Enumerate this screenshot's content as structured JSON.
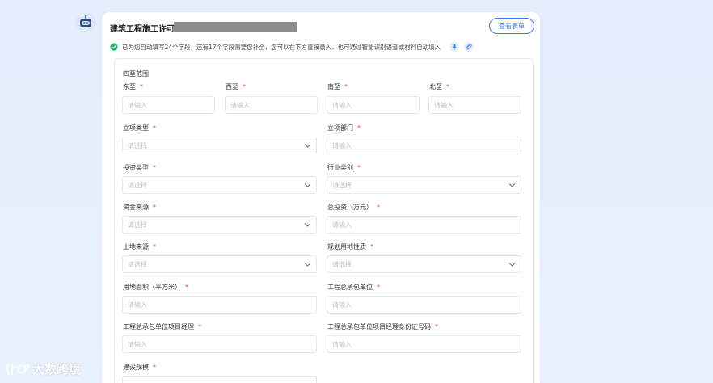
{
  "card": {
    "title": "建筑工程施工许可",
    "view_button": "查看表单",
    "notice": "已为您自动填写24个字段，还有17个字段需要您补全，您可以在下方直接录入，也可通过智能识别语音或材料自动填入"
  },
  "form": {
    "section_label": "四至范围",
    "required_mark": "*",
    "boundaries": [
      {
        "label": "东至",
        "placeholder": "请输入"
      },
      {
        "label": "西至",
        "placeholder": "请输入"
      },
      {
        "label": "南至",
        "placeholder": "请输入"
      },
      {
        "label": "北至",
        "placeholder": "请输入"
      }
    ],
    "rows": [
      [
        {
          "label": "立项类型",
          "placeholder": "请选择",
          "kind": "select"
        },
        {
          "label": "立项部门",
          "placeholder": "请输入",
          "kind": "input"
        }
      ],
      [
        {
          "label": "投资类型",
          "placeholder": "请选择",
          "kind": "select"
        },
        {
          "label": "行业类别",
          "placeholder": "请选择",
          "kind": "select"
        }
      ],
      [
        {
          "label": "资金来源",
          "placeholder": "请选择",
          "kind": "select"
        },
        {
          "label": "总投资（万元）",
          "placeholder": "请输入",
          "kind": "input"
        }
      ],
      [
        {
          "label": "土地来源",
          "placeholder": "请选择",
          "kind": "select"
        },
        {
          "label": "规划用地性质",
          "placeholder": "请选择",
          "kind": "select"
        }
      ],
      [
        {
          "label": "用地面积（平方米）",
          "placeholder": "请输入",
          "kind": "input"
        },
        {
          "label": "工程总承包单位",
          "placeholder": "请输入",
          "kind": "input"
        }
      ],
      [
        {
          "label": "工程总承包单位项目经理",
          "placeholder": "请输入",
          "kind": "input"
        },
        {
          "label": "工程总承包单位项目经理身份证号码",
          "placeholder": "请输入",
          "kind": "input"
        }
      ]
    ],
    "last_label": "建设规模"
  },
  "watermark": "大数跨境",
  "colors": {
    "accent": "#3d7cf4",
    "success": "#1fb36b",
    "required": "#e04848"
  },
  "icons": {
    "avatar": "robot-icon",
    "notice": "check-circle-icon",
    "mic": "microphone-icon",
    "attach": "paperclip-icon",
    "select": "chevron-down-icon"
  }
}
